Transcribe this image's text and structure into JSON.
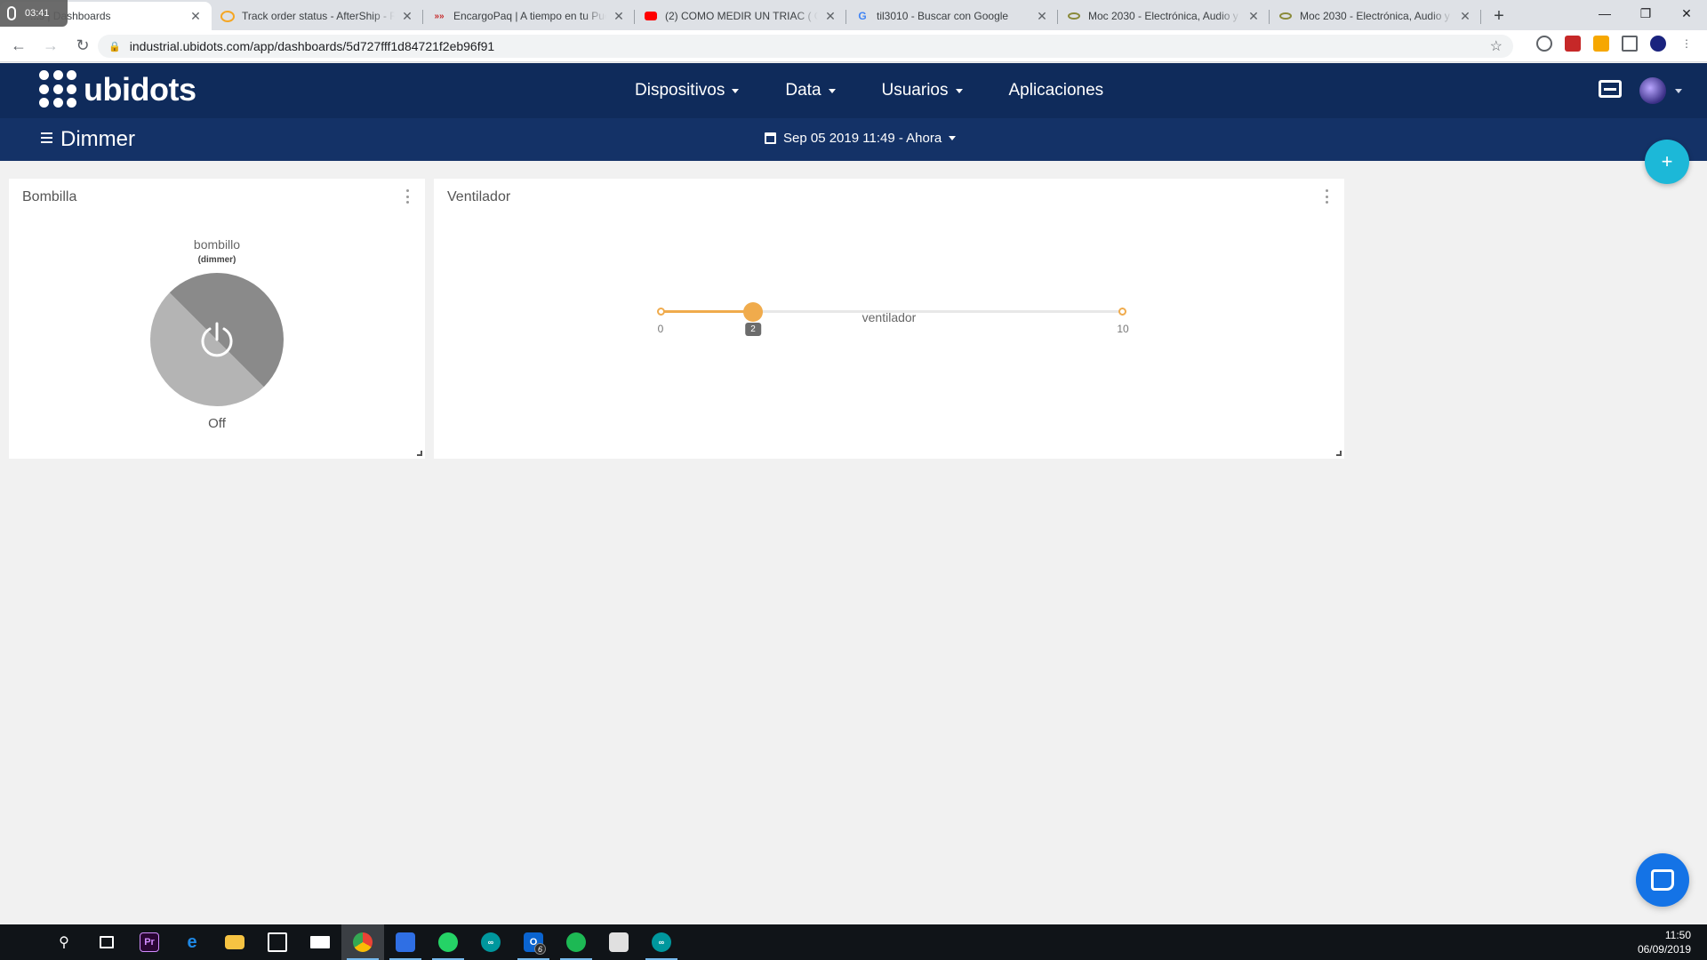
{
  "browser": {
    "recorder_time": "03:41",
    "tabs": [
      {
        "title": "...s | Dashboards",
        "favicon": "ubidots-icon",
        "active": true
      },
      {
        "title": "Track order status - AfterShip - R",
        "favicon": "aftership-icon",
        "active": false
      },
      {
        "title": "EncargoPaq | A tiempo en tu Pue",
        "favicon": "encargopaq-icon",
        "active": false
      },
      {
        "title": "(2) COMO MEDIR UN TRIAC ( CO",
        "favicon": "youtube-icon",
        "active": false
      },
      {
        "title": "til3010 - Buscar con Google",
        "favicon": "google-icon",
        "active": false
      },
      {
        "title": "Moc 2030 - Electrónica, Audio y V",
        "favicon": "moc-icon",
        "active": false
      },
      {
        "title": "Moc 2030 - Electrónica, Audio y V",
        "favicon": "moc-icon",
        "active": false
      }
    ],
    "url": "industrial.ubidots.com/app/dashboards/5d727fff1d84721f2eb96f91"
  },
  "app": {
    "logo_text": "ubidots",
    "nav": [
      {
        "label": "Dispositivos",
        "has_caret": true
      },
      {
        "label": "Data",
        "has_caret": true
      },
      {
        "label": "Usuarios",
        "has_caret": true
      },
      {
        "label": "Aplicaciones",
        "has_caret": false
      }
    ],
    "dashboard_title": "Dimmer",
    "date_range": "Sep 05 2019 11:49 - Ahora",
    "fab_label": "+",
    "colors": {
      "header": "#0f2b5b",
      "subheader": "#143267",
      "accent": "#1cb8d8",
      "slider": "#f0ab4c"
    }
  },
  "widgets": {
    "bombilla": {
      "title": "Bombilla",
      "variable": "bombillo",
      "device": "(dimmer)",
      "state": "Off"
    },
    "ventilador": {
      "title": "Ventilador",
      "variable": "ventilador",
      "min_label": "0",
      "max_label": "10",
      "value_label": "2",
      "min": 0,
      "max": 10,
      "value": 2
    }
  },
  "taskbar": {
    "time": "11:50",
    "date": "06/09/2019",
    "outlook_badge": "6"
  }
}
